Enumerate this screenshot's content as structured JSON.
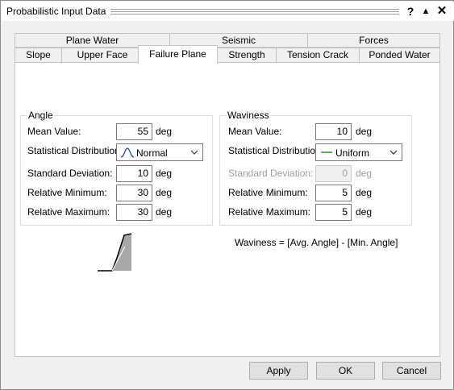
{
  "window": {
    "title": "Probabilistic Input Data",
    "help": "?",
    "collapse": "▲",
    "close": "✕"
  },
  "tabs_row1": [
    "Plane Water",
    "Seismic",
    "Forces"
  ],
  "tabs_row2": [
    "Slope",
    "Upper Face",
    "Failure Plane",
    "Strength",
    "Tension Crack",
    "Ponded Water"
  ],
  "active_tab": "Failure Plane",
  "angle": {
    "title": "Angle",
    "mean_label": "Mean Value:",
    "mean_value": "55",
    "dist_label": "Statistical Distribution:",
    "dist_value": "Normal",
    "dist_icon": "normal-curve-icon",
    "std_label": "Standard Deviation:",
    "std_value": "10",
    "relmin_label": "Relative Minimum:",
    "relmin_value": "30",
    "relmax_label": "Relative Maximum:",
    "relmax_value": "30",
    "unit": "deg"
  },
  "waviness": {
    "title": "Waviness",
    "mean_label": "Mean Value:",
    "mean_value": "10",
    "dist_label": "Statistical Distribution:",
    "dist_value": "Uniform",
    "dist_icon": "uniform-line-icon",
    "std_label": "Standard Deviation:",
    "std_value": "0",
    "relmin_label": "Relative Minimum:",
    "relmin_value": "5",
    "relmax_label": "Relative Maximum:",
    "relmax_value": "5",
    "unit": "deg",
    "formula": "Waviness = [Avg. Angle] - [Min. Angle]"
  },
  "colors": {
    "accent_curve": "#1f3fbf",
    "uniform_line": "#1a7a1a",
    "slope_fill": "#a8a8a8"
  },
  "buttons": {
    "apply": "Apply",
    "ok": "OK",
    "cancel": "Cancel"
  }
}
